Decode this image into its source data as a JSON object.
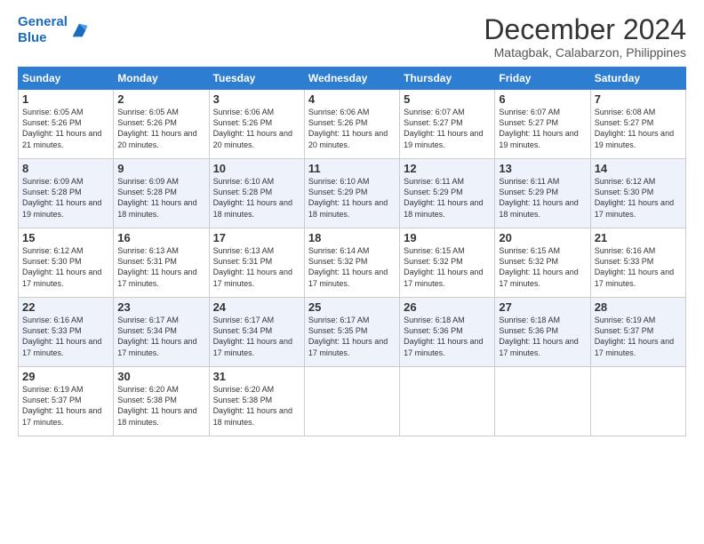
{
  "header": {
    "logo_line1": "General",
    "logo_line2": "Blue",
    "month": "December 2024",
    "location": "Matagbak, Calabarzon, Philippines"
  },
  "weekdays": [
    "Sunday",
    "Monday",
    "Tuesday",
    "Wednesday",
    "Thursday",
    "Friday",
    "Saturday"
  ],
  "weeks": [
    [
      {
        "day": "1",
        "rise": "6:05 AM",
        "set": "5:26 PM",
        "daylight": "11 hours and 21 minutes."
      },
      {
        "day": "2",
        "rise": "6:05 AM",
        "set": "5:26 PM",
        "daylight": "11 hours and 20 minutes."
      },
      {
        "day": "3",
        "rise": "6:06 AM",
        "set": "5:26 PM",
        "daylight": "11 hours and 20 minutes."
      },
      {
        "day": "4",
        "rise": "6:06 AM",
        "set": "5:26 PM",
        "daylight": "11 hours and 20 minutes."
      },
      {
        "day": "5",
        "rise": "6:07 AM",
        "set": "5:27 PM",
        "daylight": "11 hours and 19 minutes."
      },
      {
        "day": "6",
        "rise": "6:07 AM",
        "set": "5:27 PM",
        "daylight": "11 hours and 19 minutes."
      },
      {
        "day": "7",
        "rise": "6:08 AM",
        "set": "5:27 PM",
        "daylight": "11 hours and 19 minutes."
      }
    ],
    [
      {
        "day": "8",
        "rise": "6:09 AM",
        "set": "5:28 PM",
        "daylight": "11 hours and 19 minutes."
      },
      {
        "day": "9",
        "rise": "6:09 AM",
        "set": "5:28 PM",
        "daylight": "11 hours and 18 minutes."
      },
      {
        "day": "10",
        "rise": "6:10 AM",
        "set": "5:28 PM",
        "daylight": "11 hours and 18 minutes."
      },
      {
        "day": "11",
        "rise": "6:10 AM",
        "set": "5:29 PM",
        "daylight": "11 hours and 18 minutes."
      },
      {
        "day": "12",
        "rise": "6:11 AM",
        "set": "5:29 PM",
        "daylight": "11 hours and 18 minutes."
      },
      {
        "day": "13",
        "rise": "6:11 AM",
        "set": "5:29 PM",
        "daylight": "11 hours and 18 minutes."
      },
      {
        "day": "14",
        "rise": "6:12 AM",
        "set": "5:30 PM",
        "daylight": "11 hours and 17 minutes."
      }
    ],
    [
      {
        "day": "15",
        "rise": "6:12 AM",
        "set": "5:30 PM",
        "daylight": "11 hours and 17 minutes."
      },
      {
        "day": "16",
        "rise": "6:13 AM",
        "set": "5:31 PM",
        "daylight": "11 hours and 17 minutes."
      },
      {
        "day": "17",
        "rise": "6:13 AM",
        "set": "5:31 PM",
        "daylight": "11 hours and 17 minutes."
      },
      {
        "day": "18",
        "rise": "6:14 AM",
        "set": "5:32 PM",
        "daylight": "11 hours and 17 minutes."
      },
      {
        "day": "19",
        "rise": "6:15 AM",
        "set": "5:32 PM",
        "daylight": "11 hours and 17 minutes."
      },
      {
        "day": "20",
        "rise": "6:15 AM",
        "set": "5:32 PM",
        "daylight": "11 hours and 17 minutes."
      },
      {
        "day": "21",
        "rise": "6:16 AM",
        "set": "5:33 PM",
        "daylight": "11 hours and 17 minutes."
      }
    ],
    [
      {
        "day": "22",
        "rise": "6:16 AM",
        "set": "5:33 PM",
        "daylight": "11 hours and 17 minutes."
      },
      {
        "day": "23",
        "rise": "6:17 AM",
        "set": "5:34 PM",
        "daylight": "11 hours and 17 minutes."
      },
      {
        "day": "24",
        "rise": "6:17 AM",
        "set": "5:34 PM",
        "daylight": "11 hours and 17 minutes."
      },
      {
        "day": "25",
        "rise": "6:17 AM",
        "set": "5:35 PM",
        "daylight": "11 hours and 17 minutes."
      },
      {
        "day": "26",
        "rise": "6:18 AM",
        "set": "5:36 PM",
        "daylight": "11 hours and 17 minutes."
      },
      {
        "day": "27",
        "rise": "6:18 AM",
        "set": "5:36 PM",
        "daylight": "11 hours and 17 minutes."
      },
      {
        "day": "28",
        "rise": "6:19 AM",
        "set": "5:37 PM",
        "daylight": "11 hours and 17 minutes."
      }
    ],
    [
      {
        "day": "29",
        "rise": "6:19 AM",
        "set": "5:37 PM",
        "daylight": "11 hours and 17 minutes."
      },
      {
        "day": "30",
        "rise": "6:20 AM",
        "set": "5:38 PM",
        "daylight": "11 hours and 18 minutes."
      },
      {
        "day": "31",
        "rise": "6:20 AM",
        "set": "5:38 PM",
        "daylight": "11 hours and 18 minutes."
      },
      null,
      null,
      null,
      null
    ]
  ]
}
